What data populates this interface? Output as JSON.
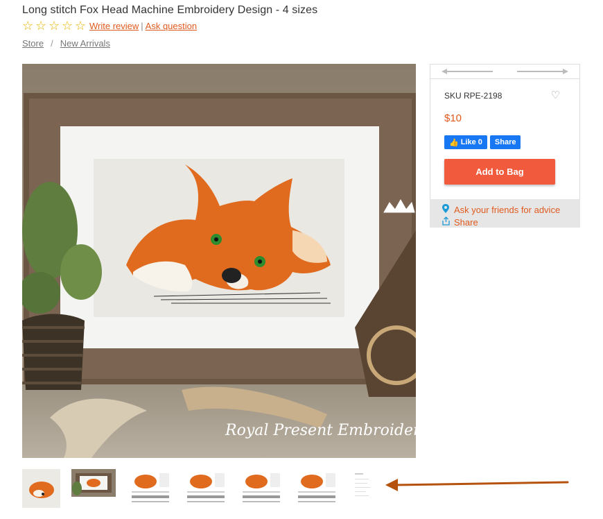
{
  "product": {
    "title": "Long stitch Fox Head Machine Embroidery Design - 4 sizes",
    "rating_stars": 0,
    "write_review": "Write review",
    "separator": "|",
    "ask_question": "Ask question"
  },
  "breadcrumb": {
    "items": [
      "Store",
      "New Arrivals"
    ],
    "separator": "/"
  },
  "main_image": {
    "watermark": "Royal Present Embroidery",
    "alt": "Fox head embroidery in wooden frame"
  },
  "thumbnails": {
    "count": 7
  },
  "side": {
    "sku": "SKU RPE-2198",
    "price": "$10",
    "fb_like": "Like 0",
    "fb_share": "Share",
    "add_to_bag": "Add to Bag",
    "ask_friends": "Ask your friends for advice",
    "share": "Share"
  },
  "colors": {
    "accent": "#e05a1e",
    "button": "#f15a3c",
    "facebook": "#1877f2",
    "star": "#e9b400",
    "annotation_arrow": "#b5520e"
  },
  "icons": [
    "star-outline-icon",
    "heart-icon",
    "map-pin-icon",
    "share-icon",
    "thumbs-up-icon",
    "arrow-left-icon",
    "arrow-right-icon"
  ]
}
